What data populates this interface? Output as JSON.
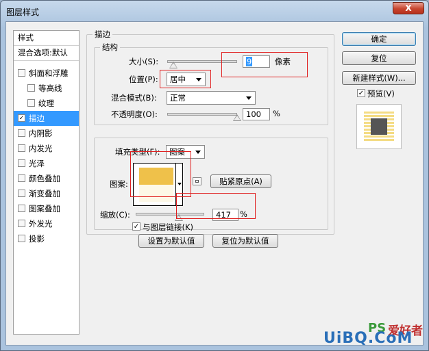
{
  "window": {
    "title": "图层样式",
    "close_glyph": "X"
  },
  "sidebar": {
    "header_styles": "样式",
    "header_blend": "混合选项:默认",
    "items": [
      {
        "label": "斜面和浮雕",
        "checked": false,
        "checkmark": "",
        "indent": false
      },
      {
        "label": "等高线",
        "checked": false,
        "checkmark": "",
        "indent": true
      },
      {
        "label": "纹理",
        "checked": false,
        "checkmark": "",
        "indent": true
      },
      {
        "label": "描边",
        "checked": true,
        "checkmark": "✓",
        "indent": false,
        "selected": true
      },
      {
        "label": "内阴影",
        "checked": false,
        "checkmark": "",
        "indent": false
      },
      {
        "label": "内发光",
        "checked": false,
        "checkmark": "",
        "indent": false
      },
      {
        "label": "光泽",
        "checked": false,
        "checkmark": "",
        "indent": false
      },
      {
        "label": "颜色叠加",
        "checked": false,
        "checkmark": "",
        "indent": false
      },
      {
        "label": "渐变叠加",
        "checked": false,
        "checkmark": "",
        "indent": false
      },
      {
        "label": "图案叠加",
        "checked": false,
        "checkmark": "",
        "indent": false
      },
      {
        "label": "外发光",
        "checked": false,
        "checkmark": "",
        "indent": false
      },
      {
        "label": "投影",
        "checked": false,
        "checkmark": "",
        "indent": false
      }
    ]
  },
  "stroke": {
    "group_title": "描边",
    "structure_title": "结构",
    "size_label": "大小(S):",
    "size_value": "9",
    "size_unit": "像素",
    "size_slider": 0.09,
    "position_label": "位置(P):",
    "position_value": "居中",
    "blend_label": "混合模式(B):",
    "blend_value": "正常",
    "opacity_label": "不透明度(O):",
    "opacity_value": "100",
    "opacity_unit": "%",
    "opacity_slider": 1.0,
    "fill_type_label": "填充类型(F):",
    "fill_type_value": "图案",
    "pattern_label": "图案:",
    "snap_button": "贴紧原点(A)",
    "scale_label": "缩放(C):",
    "scale_value": "417",
    "scale_unit": "%",
    "scale_slider": 0.63,
    "link_label": "与图层链接(K)",
    "link_checked": true,
    "link_checkmark": "✓",
    "make_default_button": "设置为默认值",
    "reset_default_button": "复位为默认值"
  },
  "actions": {
    "ok": "确定",
    "reset": "复位",
    "new_style": "新建样式(W)...",
    "preview_label": "预览(V)",
    "preview_checked": true,
    "preview_checkmark": "✓"
  },
  "watermark": {
    "ps_text": "PS",
    "site_text": "爱好者",
    "url_text": "UiBQ.CoM"
  },
  "colors": {
    "pattern_yellow": "#efc14a",
    "pattern_cream": "#fdf8e7",
    "preview_stripe": "#f4dc84",
    "preview_center": "#555555",
    "highlight": "#3399ff",
    "annotation_red": "#e02020"
  }
}
